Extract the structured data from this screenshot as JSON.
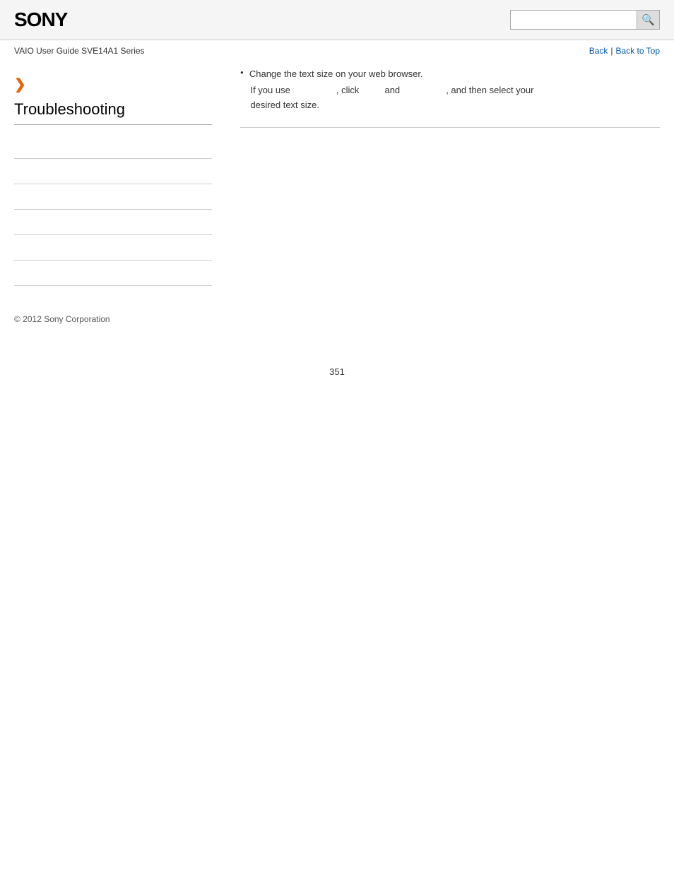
{
  "header": {
    "logo": "SONY",
    "search_placeholder": "",
    "search_icon": "🔍"
  },
  "breadcrumb": {
    "guide_title": "VAIO User Guide SVE14A1 Series",
    "back_label": "Back",
    "separator": "|",
    "back_to_top_label": "Back to Top"
  },
  "sidebar": {
    "arrow": "❯",
    "title": "Troubleshooting",
    "links": [
      {
        "label": ""
      },
      {
        "label": ""
      },
      {
        "label": ""
      },
      {
        "label": ""
      },
      {
        "label": ""
      },
      {
        "label": ""
      }
    ]
  },
  "content": {
    "bullet1": "Change the text size on your web browser.",
    "paragraph1": "If you use",
    "click_text": ", click",
    "and_text": "and",
    "then_text": ", and then select your",
    "paragraph2": "desired text size."
  },
  "footer": {
    "copyright": "© 2012 Sony Corporation"
  },
  "page_number": "351"
}
